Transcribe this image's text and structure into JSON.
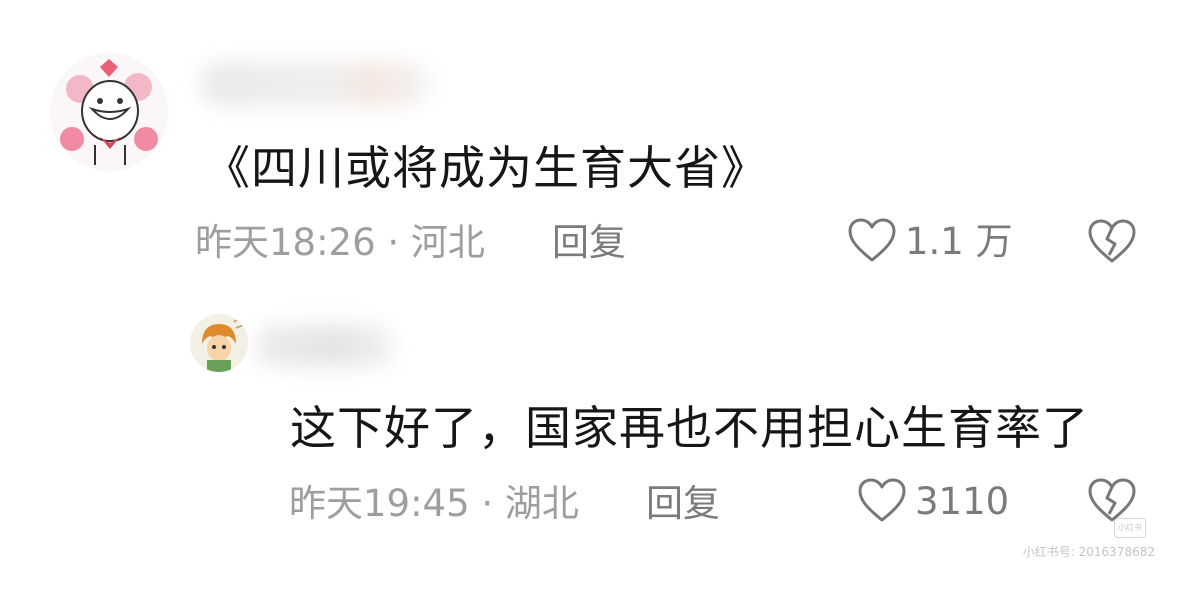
{
  "comments": [
    {
      "text": "《四川或将成为生育大省》",
      "meta": "昨天18:26 · 河北",
      "reply_label": "回复",
      "like_count": "1.1 万"
    }
  ],
  "replies": [
    {
      "text": "这下好了，国家再也不用担心生育率了",
      "meta": "昨天19:45 · 湖北",
      "reply_label": "回复",
      "like_count": "3110"
    }
  ],
  "watermark": {
    "badge": "小红书",
    "text": "小红书号: 2016378682"
  },
  "colors": {
    "text": "#161616",
    "meta": "#9e9e9e",
    "action": "#7b7b7b",
    "avatar_accent": "#e8607a"
  },
  "icons": [
    "heart-outline-icon",
    "broken-heart-icon"
  ]
}
